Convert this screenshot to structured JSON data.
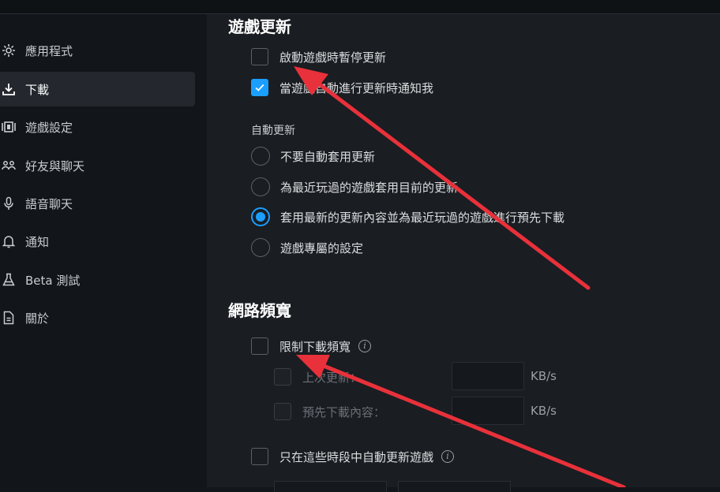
{
  "sidebar": {
    "items": [
      {
        "label": "應用程式",
        "icon": "gear-icon",
        "active": false
      },
      {
        "label": "下載",
        "icon": "download-icon",
        "active": true
      },
      {
        "label": "遊戲設定",
        "icon": "game-settings-icon",
        "active": false
      },
      {
        "label": "好友與聊天",
        "icon": "friends-icon",
        "active": false
      },
      {
        "label": "語音聊天",
        "icon": "microphone-icon",
        "active": false
      },
      {
        "label": "通知",
        "icon": "bell-icon",
        "active": false
      },
      {
        "label": "Beta 測試",
        "icon": "flask-icon",
        "active": false
      },
      {
        "label": "關於",
        "icon": "document-icon",
        "active": false
      }
    ]
  },
  "game_updates": {
    "title": "遊戲更新",
    "pause_while_playing": {
      "label": "啟動遊戲時暫停更新",
      "checked": false
    },
    "notify_on_auto_update": {
      "label": "當遊戲自動進行更新時通知我",
      "checked": true
    },
    "auto_update_title": "自動更新",
    "auto_update_options": [
      {
        "label": "不要自動套用更新",
        "selected": false
      },
      {
        "label": "為最近玩過的遊戲套用目前的更新",
        "selected": false
      },
      {
        "label": "套用最新的更新內容並為最近玩過的遊戲進行預先下載",
        "selected": true
      },
      {
        "label": "遊戲專屬的設定",
        "selected": false
      }
    ]
  },
  "bandwidth": {
    "title": "網路頻寬",
    "limit_download": {
      "label": "限制下載頻寬",
      "checked": false
    },
    "last_update": {
      "label": "上次更新：",
      "unit": "KB/s"
    },
    "predownload": {
      "label": "預先下載內容：",
      "unit": "KB/s"
    },
    "schedule": {
      "label": "只在這些時段中自動更新遊戲",
      "checked": false
    }
  },
  "colors": {
    "accent": "#1a9fff",
    "annotation_arrow": "#e8313a",
    "background": "#1a1d22",
    "sidebar_bg": "#121519"
  }
}
